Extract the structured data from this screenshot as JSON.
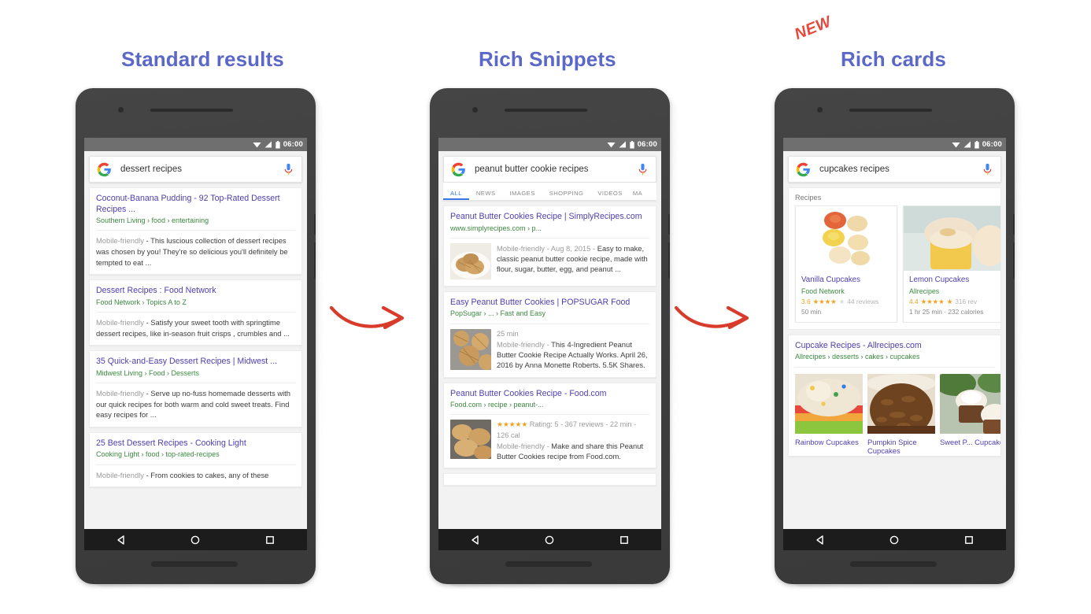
{
  "headings": {
    "standard": "Standard results",
    "rich_snippets": "Rich Snippets",
    "rich_cards": "Rich cards",
    "new_badge": "NEW",
    "title_color": "#5b68c8",
    "badge_color": "#e8483c",
    "arrow_color": "#d93b2b"
  },
  "phones": [
    {
      "id": "standard-results",
      "status": {
        "time": "06:00"
      },
      "search": {
        "query": "dessert recipes",
        "placeholder": "Search",
        "logo": "google-g-icon",
        "mic": "microphone-icon"
      },
      "tabs": [],
      "results": [
        {
          "title": "Coconut-Banana Pudding - 92 Top-Rated Dessert Recipes ...",
          "url": "Southern Living › food › entertaining",
          "label": "Mobile-friendly",
          "snippet": "- This luscious collection of dessert recipes was chosen by you! They're so delicious you'll definitely be tempted to eat ..."
        },
        {
          "title": "Dessert Recipes : Food Network",
          "url": "Food Network › Topics A to Z",
          "label": "Mobile-friendly",
          "snippet": "- Satisfy your sweet tooth with springtime dessert recipes, like in-season fruit crisps , crumbles and ..."
        },
        {
          "title": "35 Quick-and-Easy Dessert Recipes | Midwest ...",
          "url": "Midwest Living › Food › Desserts",
          "label": "Mobile-friendly",
          "snippet": "- Serve up no-fuss homemade desserts with our quick recipes for both warm and cold sweet treats. Find easy recipes for ..."
        },
        {
          "title": "25 Best Dessert Recipes - Cooking Light",
          "url": "Cooking Light › food › top-rated-recipes",
          "label": "Mobile-friendly",
          "snippet": "- From cookies to cakes, any of these"
        }
      ]
    },
    {
      "id": "rich-snippets",
      "status": {
        "time": "06:00"
      },
      "search": {
        "query": "peanut butter cookie recipes",
        "placeholder": "Search",
        "logo": "google-g-icon",
        "mic": "microphone-icon"
      },
      "tabs": [
        {
          "label": "ALL",
          "active": true
        },
        {
          "label": "NEWS",
          "active": false
        },
        {
          "label": "IMAGES",
          "active": false
        },
        {
          "label": "SHOPPING",
          "active": false
        },
        {
          "label": "VIDEOS",
          "active": false
        },
        {
          "label": "MA",
          "active": false
        }
      ],
      "results": [
        {
          "title": "Peanut Butter Cookies Recipe | SimplyRecipes.com",
          "url": "www.simplyrecipes.com › p...",
          "thumb": "peanut-butter-cookies-plate",
          "meta": "",
          "label": "Mobile-friendly - Aug 8, 2015 -",
          "snippet": "Easy to make, classic peanut butter cookie recipe, made with flour, sugar, butter, egg, and peanut ..."
        },
        {
          "title": "Easy Peanut Butter Cookies | POPSUGAR Food",
          "url": "PopSugar › ... › Fast and Easy",
          "thumb": "peanut-butter-cookies-tray",
          "meta": "25 min",
          "label": "Mobile-friendly -",
          "snippet": "This 4-Ingredient Peanut Butter Cookie Recipe Actually Works. April 26, 2016 by Anna Monette Roberts. 5.5K Shares."
        },
        {
          "title": "Peanut Butter Cookies Recipe - Food.com",
          "url": "Food.com › recipe › peanut-...",
          "thumb": "peanut-butter-cookies-stack",
          "stars": "★★★★★",
          "meta": "Rating: 5 - 367 reviews - 22 min - 126 cal",
          "label": "Mobile-friendly -",
          "snippet": "Make and share this Peanut Butter Cookies recipe from Food.com."
        }
      ]
    },
    {
      "id": "rich-cards",
      "status": {
        "time": "06:00"
      },
      "search": {
        "query": "cupcakes recipes",
        "placeholder": "Search",
        "logo": "google-g-icon",
        "mic": "microphone-icon"
      },
      "rich_cards": {
        "label": "Recipes",
        "cards": [
          {
            "name": "Vanilla Cupcakes",
            "source": "Food Network",
            "rating_value": "3.6",
            "stars": "★★★★",
            "half_star": "★",
            "reviews": "44 reviews",
            "time": "50 min",
            "image": "vanilla-cupcakes-photo"
          },
          {
            "name": "Lemon Cupcakes",
            "source": "Allrecipes",
            "rating_value": "4.4",
            "stars": "★★★★",
            "half_star": "★",
            "reviews": "316 rev",
            "time": "1 hr 25 min · 232 calories",
            "image": "lemon-cupcakes-photo"
          }
        ]
      },
      "result": {
        "title": "Cupcake Recipes - Allrecipes.com",
        "url": "Allrecipes › desserts › cakes › cupcakes",
        "gallery": [
          {
            "caption": "Rainbow Cupcakes",
            "image": "rainbow-cupcake-photo"
          },
          {
            "caption": "Pumpkin Spice Cupcakes",
            "image": "pumpkin-spice-cupcake-photo"
          },
          {
            "caption": "Sweet P... Cupcake",
            "image": "sweet-potato-cupcake-photo"
          }
        ]
      }
    }
  ],
  "navbar": {
    "back": "back-triangle-icon",
    "home": "home-circle-icon",
    "recents": "recents-square-icon"
  }
}
